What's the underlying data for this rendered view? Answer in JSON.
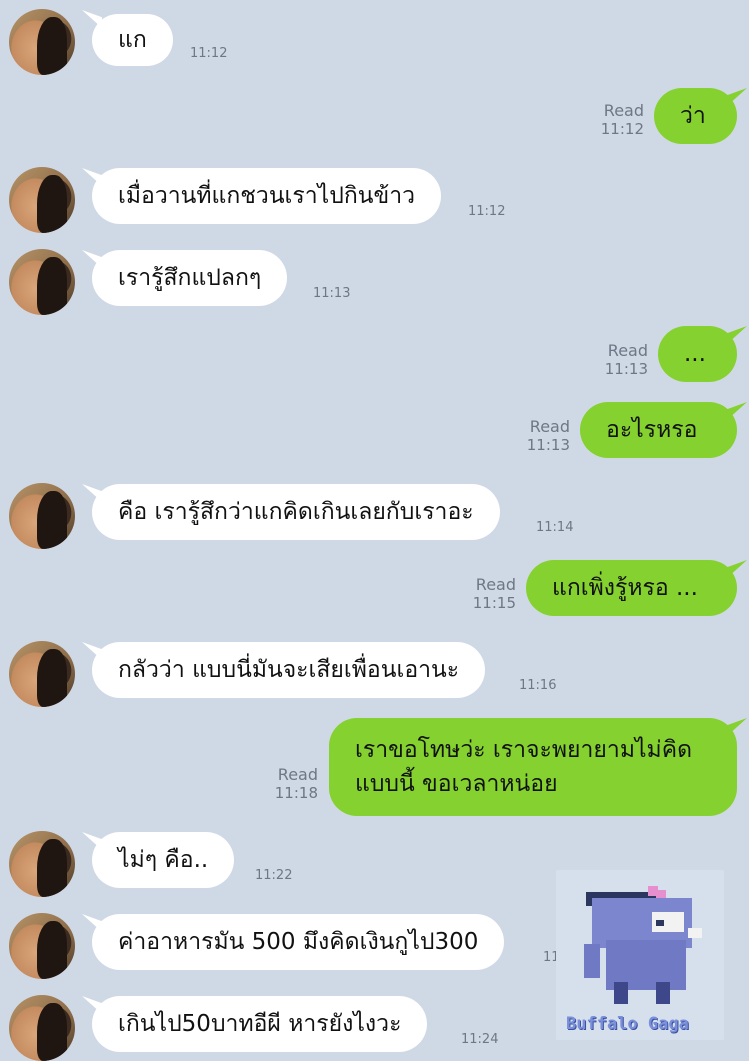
{
  "messages": [
    {
      "id": "m1",
      "side": "in",
      "text": "แก",
      "time": "11:12"
    },
    {
      "id": "m2",
      "side": "out",
      "text": "ว่า",
      "time": "11:12",
      "read": "Read"
    },
    {
      "id": "m3",
      "side": "in",
      "text": "เมื่อวานที่แกชวนเราไปกินข้าว",
      "time": "11:12"
    },
    {
      "id": "m4",
      "side": "in",
      "text": "เรารู้สึกแปลกๆ",
      "time": "11:13"
    },
    {
      "id": "m5",
      "side": "out",
      "text": "...",
      "time": "11:13",
      "read": "Read"
    },
    {
      "id": "m6",
      "side": "out",
      "text": "อะไรหรอ",
      "time": "11:13",
      "read": "Read"
    },
    {
      "id": "m7",
      "side": "in",
      "text": "คือ เรารู้สึกว่าแกคิดเกินเลยกับเราอะ",
      "time": "11:14"
    },
    {
      "id": "m8",
      "side": "out",
      "text": "แกเพิ่งรู้หรอ ...",
      "time": "11:15",
      "read": "Read"
    },
    {
      "id": "m9",
      "side": "in",
      "text": "กลัวว่า แบบนี่มันจะเสียเพื่อนเอานะ",
      "time": "11:16"
    },
    {
      "id": "m10",
      "side": "out",
      "text_line1": "เราขอโทษว่ะ เราจะพยายามไม่คิด",
      "text_line2": "แบบนี้ ขอเวลาหน่อย",
      "time": "11:18",
      "read": "Read"
    },
    {
      "id": "m11",
      "side": "in",
      "text": "ไม่ๆ คือ..",
      "time": "11:22"
    },
    {
      "id": "m12",
      "side": "in",
      "text": "ค่าอาหารมัน 500 มึงคิดเงินกูไป300",
      "time": "11:23"
    },
    {
      "id": "m13",
      "side": "in",
      "text": "เกินไป50บาทอีผี หารยังไงวะ",
      "time": "11:24"
    }
  ],
  "sticker": {
    "icon": "buffalo-gaga-sticker",
    "label": "Buffalo Gaga"
  }
}
